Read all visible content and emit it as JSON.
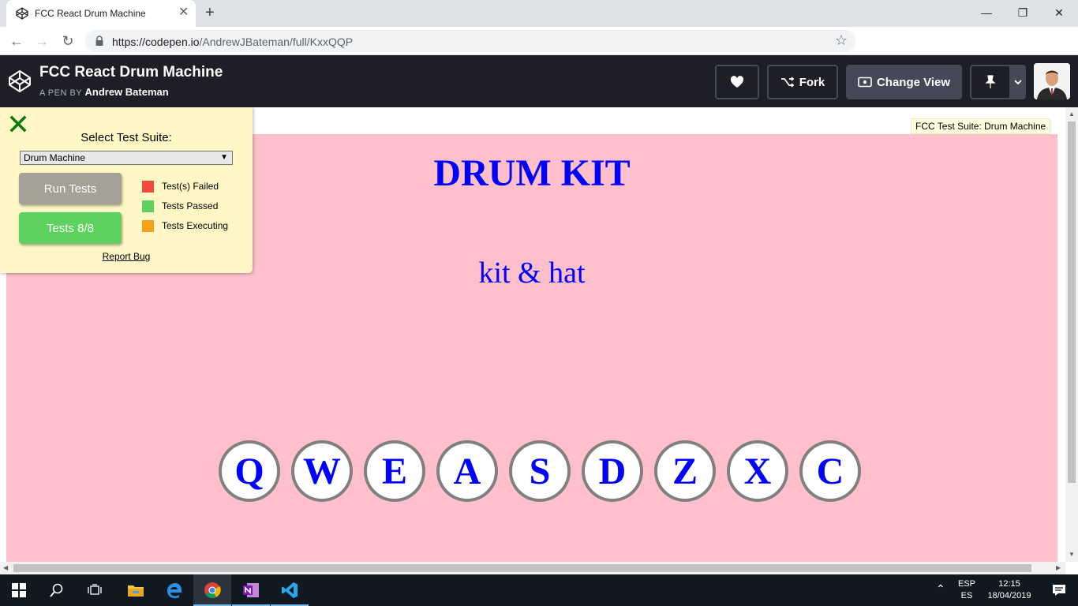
{
  "browser": {
    "tab_title": "FCC React Drum Machine",
    "tab_close": "✕",
    "new_tab": "+",
    "url_host": "https://codepen.io",
    "url_path": "/AndrewJBateman/full/KxxQQP",
    "window_controls": {
      "minimize": "—",
      "restore": "❐",
      "close": "✕"
    }
  },
  "codepen": {
    "title": "FCC React Drum Machine",
    "byline_prefix": "A PEN BY",
    "author": "Andrew Bateman",
    "fork_label": "Fork",
    "change_view_label": "Change View"
  },
  "drum_machine": {
    "title": "DRUM KIT",
    "display": "kit & hat",
    "pads": [
      "Q",
      "W",
      "E",
      "A",
      "S",
      "D",
      "Z",
      "X",
      "C"
    ]
  },
  "tooltip": "FCC Test Suite: Drum Machine",
  "fcc_panel": {
    "select_label": "Select Test Suite:",
    "selected_suite": "Drum Machine",
    "run_tests_label": "Run Tests",
    "tests_result_label": "Tests 8/8",
    "legend": [
      {
        "label": "Test(s) Failed",
        "color": "#f44a3b"
      },
      {
        "label": "Tests Passed",
        "color": "#5ed25e"
      },
      {
        "label": "Tests Executing",
        "color": "#f7a11a"
      }
    ],
    "report_bug": "Report Bug"
  },
  "taskbar": {
    "lang_top": "ESP",
    "lang_bottom": "ES",
    "time": "12:15",
    "date": "18/04/2019"
  },
  "colors": {
    "page_bg": "#ffc0cb",
    "drum_text": "#0000ff",
    "codepen_header": "#1e1f26"
  }
}
